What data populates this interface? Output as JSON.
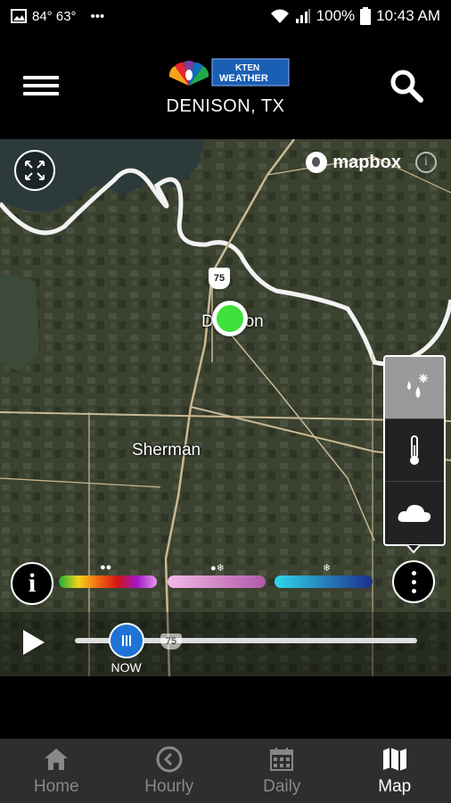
{
  "status_bar": {
    "temps": "84° 63°",
    "dots": "•••",
    "battery": "100%",
    "time": "10:43 AM"
  },
  "header": {
    "logo_text_1": "KTEN",
    "logo_text_2": "WEATHER",
    "location": "DENISON, TX"
  },
  "map": {
    "attribution": "mapbox",
    "info_small": "i",
    "labels": {
      "denison": "Denison",
      "sherman": "Sherman"
    },
    "highway_shield": "75",
    "highway_shield_2": "75"
  },
  "layers": {
    "items": [
      {
        "name": "precipitation",
        "active": true
      },
      {
        "name": "temperature",
        "active": false
      },
      {
        "name": "clouds",
        "active": false
      }
    ]
  },
  "legend": {
    "info_label": "i",
    "bars": [
      {
        "name": "rain",
        "colors": [
          "#1fae3a",
          "#f2d21a",
          "#f06a14",
          "#d01414",
          "#a316c8",
          "#e29be8"
        ]
      },
      {
        "name": "mix",
        "colors": [
          "#f3b9e6",
          "#b05aa8"
        ]
      },
      {
        "name": "snow",
        "colors": [
          "#2fd8ec",
          "#1e2e8c"
        ]
      }
    ]
  },
  "timeline": {
    "now_label": "NOW",
    "position": 0.15
  },
  "nav": {
    "items": [
      {
        "label": "Home",
        "active": false
      },
      {
        "label": "Hourly",
        "active": false
      },
      {
        "label": "Daily",
        "active": false
      },
      {
        "label": "Map",
        "active": true
      }
    ]
  },
  "colors": {
    "accent": "#1e73d6",
    "location_dot": "#3ee03a",
    "nav_bg": "#2e2e2e"
  }
}
